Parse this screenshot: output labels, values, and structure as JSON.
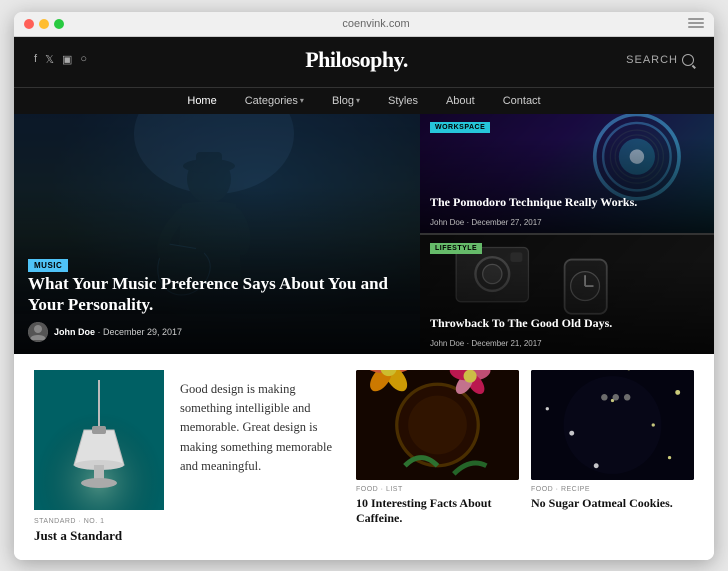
{
  "browser": {
    "address": "coenvink.com",
    "tl_red": "#ff5f57",
    "tl_yellow": "#ffbd2e",
    "tl_green": "#28ca40"
  },
  "header": {
    "logo": "Philosophy.",
    "search_label": "SEARCH",
    "social": [
      "f",
      "y",
      "in",
      "p"
    ]
  },
  "nav": {
    "items": [
      {
        "label": "Home",
        "active": true,
        "has_arrow": false
      },
      {
        "label": "Categories",
        "active": false,
        "has_arrow": true
      },
      {
        "label": "Blog",
        "active": false,
        "has_arrow": true
      },
      {
        "label": "Styles",
        "active": false,
        "has_arrow": false
      },
      {
        "label": "About",
        "active": false,
        "has_arrow": false
      },
      {
        "label": "Contact",
        "active": false,
        "has_arrow": false
      }
    ]
  },
  "hero": {
    "badge": "MUSIC",
    "title": "What Your Music Preference Says About You and Your Personality.",
    "author": "John Doe",
    "date": "December 29, 2017"
  },
  "side_articles": [
    {
      "badge": "WORKSPACE",
      "badge_class": "teal",
      "title": "The Pomodoro Technique Really Works.",
      "author": "John Doe",
      "date": "December 27, 2017"
    },
    {
      "badge": "LIFESTYLE",
      "badge_class": "green",
      "title": "Throwback To The Good Old Days.",
      "author": "John Doe",
      "date": "December 21, 2017"
    }
  ],
  "bottom": {
    "left_tag": "STANDARD · NO. 1",
    "left_title": "Just a Standard Format Post.",
    "center_quote": "Good design is making something intelligible and memorable. Great design is making something memorable and meaningful.",
    "cards": [
      {
        "tag": "FOOD · LIST",
        "title": "10 Interesting Facts About Caffeine."
      },
      {
        "tag": "FOOD · RECIPE",
        "title": "No Sugar Oatmeal Cookies."
      }
    ]
  }
}
